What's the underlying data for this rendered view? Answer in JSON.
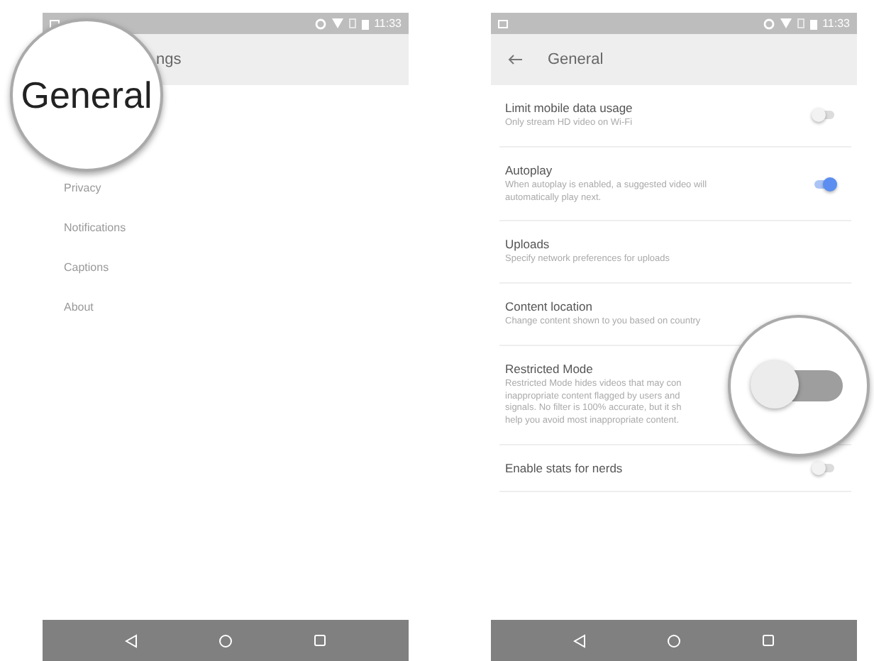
{
  "phones": [
    {
      "status_bar": {
        "time": "11:33"
      },
      "toolbar": {
        "title": "ngs",
        "back": false
      },
      "magnifier": {
        "kind": "text",
        "text": "General"
      },
      "menu_items": [
        "Privacy",
        "Notifications",
        "Captions",
        "About"
      ]
    },
    {
      "status_bar": {
        "time": "11:33"
      },
      "toolbar": {
        "title": "General",
        "back": true
      },
      "magnifier": {
        "kind": "toggle",
        "on": false
      },
      "rows": [
        {
          "kind": "toggle",
          "title": "Limit mobile data usage",
          "description_lines": [
            "Only stream HD video on Wi-Fi"
          ],
          "on": false
        },
        {
          "kind": "toggle",
          "title": "Autoplay",
          "description_lines": [
            "When autoplay is enabled, a suggested video will",
            "automatically play next."
          ],
          "on": true
        },
        {
          "kind": "plain",
          "title": "Uploads",
          "description_lines": [
            "Specify network preferences for uploads"
          ]
        },
        {
          "kind": "plain",
          "title": "Content location",
          "description_lines": [
            "Change content shown to you based on country"
          ]
        },
        {
          "kind": "plain",
          "title": "Restricted Mode",
          "description_lines": [
            "Restricted Mode hides videos that may con",
            "inappropriate content flagged by users and",
            "signals. No filter is 100% accurate, but it sh",
            "help you avoid most inappropriate content."
          ]
        },
        {
          "kind": "toggle",
          "title": "Enable stats for nerds",
          "description_lines": [],
          "on": false
        }
      ]
    }
  ]
}
